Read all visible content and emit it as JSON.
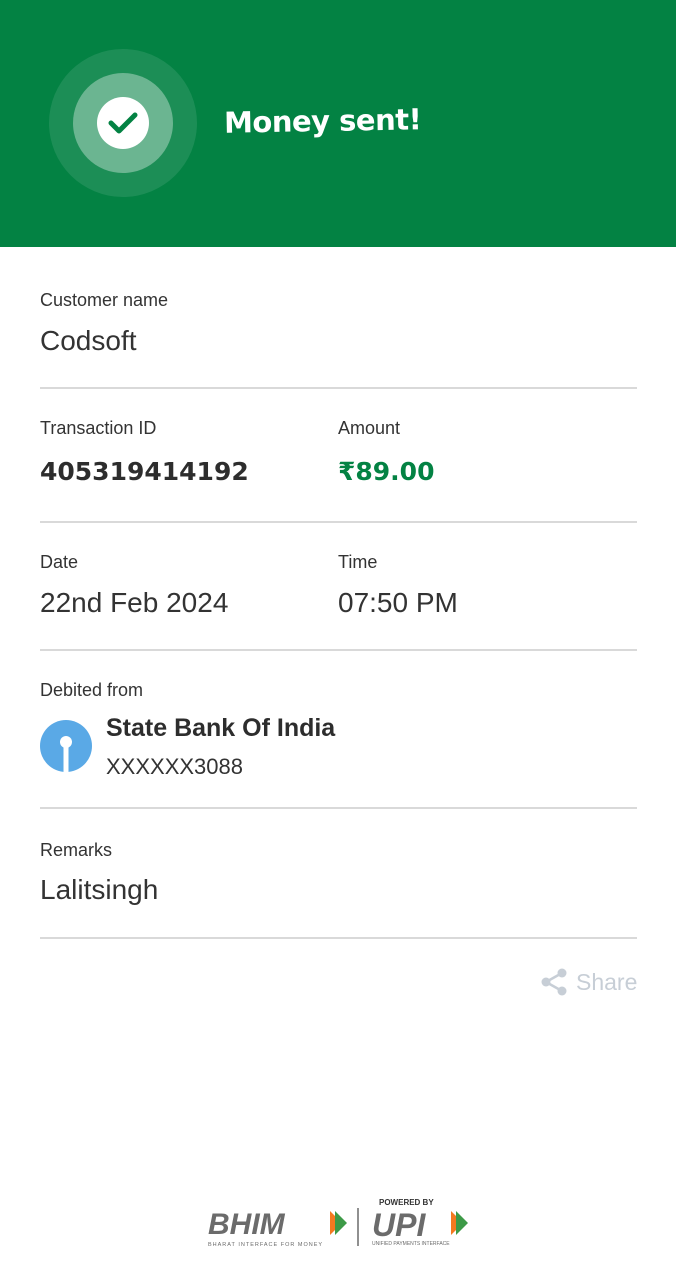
{
  "header": {
    "title": "Money sent!",
    "color": "#038243"
  },
  "customer": {
    "label": "Customer name",
    "value": "Codsoft"
  },
  "transaction": {
    "id_label": "Transaction ID",
    "id_value": "405319414192",
    "amount_label": "Amount",
    "amount_value": "₹89.00",
    "amount_color": "#038243"
  },
  "datetime": {
    "date_label": "Date",
    "date_value": "22nd Feb 2024",
    "time_label": "Time",
    "time_value": "07:50 PM"
  },
  "debited": {
    "label": "Debited from",
    "bank_name": "State Bank Of India",
    "account": "XXXXXX3088",
    "bank_icon": "sbi-logo-icon"
  },
  "remarks": {
    "label": "Remarks",
    "value": "Lalitsingh"
  },
  "share": {
    "label": "Share",
    "icon": "share-icon"
  },
  "footer": {
    "bhim": "BHIM",
    "bhim_tagline": "BHARAT INTERFACE FOR MONEY",
    "powered_by": "POWERED BY",
    "upi": "UPI",
    "upi_tagline": "UNIFIED PAYMENTS INTERFACE"
  }
}
